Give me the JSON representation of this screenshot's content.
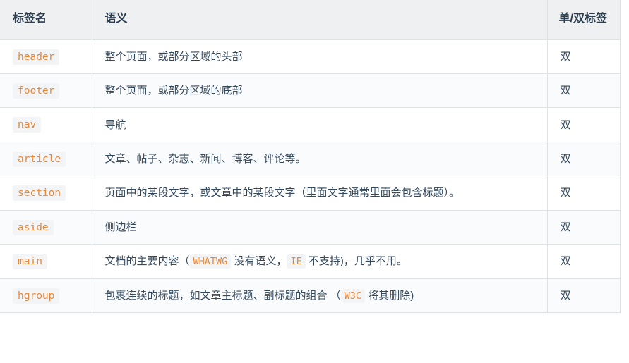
{
  "table": {
    "headers": [
      {
        "label": "标签名"
      },
      {
        "label": "语义"
      },
      {
        "label": "单/双标签"
      }
    ],
    "rows": [
      {
        "tag": "header",
        "meaning_plain": "整个页面，或部分区域的头部",
        "meaning_parts": [
          {
            "type": "text",
            "value": "整个页面，或部分区域的头部"
          }
        ],
        "type": "双"
      },
      {
        "tag": "footer",
        "meaning_plain": "整个页面，或部分区域的底部",
        "meaning_parts": [
          {
            "type": "text",
            "value": "整个页面，或部分区域的底部"
          }
        ],
        "type": "双"
      },
      {
        "tag": "nav",
        "meaning_plain": "导航",
        "meaning_parts": [
          {
            "type": "text",
            "value": "导航"
          }
        ],
        "type": "双"
      },
      {
        "tag": "article",
        "meaning_plain": "文章、帖子、杂志、新闻、博客、评论等。",
        "meaning_parts": [
          {
            "type": "text",
            "value": "文章、帖子、杂志、新闻、博客、评论等。"
          }
        ],
        "type": "双"
      },
      {
        "tag": "section",
        "meaning_plain": "页面中的某段文字，或文章中的某段文字（里面文字通常里面会包含标题）。",
        "meaning_parts": [
          {
            "type": "text",
            "value": "页面中的某段文字，或文章中的某段文字（里面文字通常里面会包含标题）。"
          }
        ],
        "type": "双"
      },
      {
        "tag": "aside",
        "meaning_plain": "侧边栏",
        "meaning_parts": [
          {
            "type": "text",
            "value": "侧边栏"
          }
        ],
        "type": "双"
      },
      {
        "tag": "main",
        "meaning_plain": "文档的主要内容（WHATWG 没有语义， IE 不支持)，几乎不用。",
        "meaning_parts": [
          {
            "type": "text",
            "value": "文档的主要内容（"
          },
          {
            "type": "code",
            "value": "WHATWG"
          },
          {
            "type": "text",
            "value": " 没有语义，"
          },
          {
            "type": "code",
            "value": "IE"
          },
          {
            "type": "text",
            "value": " 不支持)，几乎不用。"
          }
        ],
        "type": "双"
      },
      {
        "tag": "hgroup",
        "meaning_plain": "包裹连续的标题，如文章主标题、副标题的组合 （W3C 将其删除)",
        "meaning_parts": [
          {
            "type": "text",
            "value": "包裹连续的标题，如文章主标题、副标题的组合 （"
          },
          {
            "type": "code",
            "value": "W3C"
          },
          {
            "type": "text",
            "value": " 将其删除)"
          }
        ],
        "type": "双"
      }
    ]
  },
  "colors": {
    "code_text": "#e8883a",
    "code_background": "#f3f4f5",
    "header_background": "#eff0f1",
    "header_text": "#2c3e50",
    "body_text": "#34495e",
    "border": "#dfe2e5",
    "row_odd": "#ffffff",
    "row_even": "#fafbfc"
  }
}
